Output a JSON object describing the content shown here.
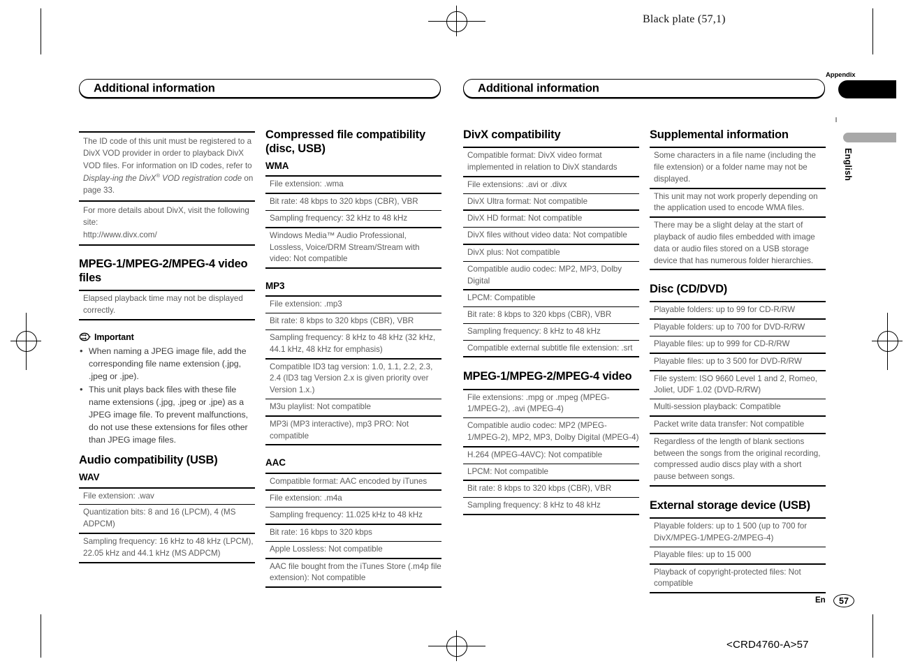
{
  "page": {
    "plate_label": "Black plate (57,1)",
    "footer_lang": "En",
    "footer_page_number": "57",
    "footer_code": "<CRD4760-A>57",
    "margin_tab_label": "Appendix",
    "margin_language": "English",
    "accent_color": "#000000",
    "tab_gray_color": "#a8a8a8",
    "body_text_color": "#5c5c5c"
  },
  "left_page": {
    "banner_title": "Additional information",
    "column1": {
      "notes": [
        {
          "id": "divx-vod-note",
          "segments": [
            {
              "text": "The ID code of this unit must be registered to a DivX VOD provider in order to playback DivX VOD files. For information on ID codes, refer to ",
              "style": "normal"
            },
            {
              "text": "Display-ing the DivX",
              "style": "italic"
            },
            {
              "text": "®",
              "style": "superscript-italic"
            },
            {
              "text": " VOD registration code",
              "style": "italic"
            },
            {
              "text": " on page 33.",
              "style": "normal"
            }
          ],
          "plain": "The ID code of this unit must be registered to a DivX VOD provider in order to playback DivX VOD files. For information on ID codes, refer to Displaying the DivX® VOD registration code on page 33."
        },
        {
          "id": "divx-site-note",
          "plain": "For more details about DivX, visit the following site:\nhttp://www.divx.com/"
        }
      ],
      "mpeg_video_files": {
        "heading": "MPEG-1/MPEG-2/MPEG-4 video files",
        "rows": [
          "Elapsed playback time may not be displayed correctly."
        ]
      },
      "important": {
        "icon": "important-icon",
        "label": "Important",
        "bullets": [
          "When naming a JPEG image file, add the corresponding file name extension (.jpg, .jpeg or .jpe).",
          "This unit plays back files with these file name extensions (.jpg, .jpeg or .jpe) as a JPEG image file. To prevent malfunctions, do not use these extensions for files other than JPEG image files."
        ]
      },
      "audio_compat_usb": {
        "heading": "Audio compatibility (USB)",
        "subheading": "WAV",
        "rows": [
          {
            "text": "File extension: .wav",
            "rule": "thin"
          },
          {
            "text": "Quantization bits: 8 and 16 (LPCM), 4 (MS ADPCM)",
            "rule": "thin"
          },
          {
            "text": "Sampling frequency: 16 kHz to 48 kHz (LPCM), 22.05 kHz and 44.1 kHz (MS ADPCM)",
            "rule": "none"
          }
        ]
      }
    },
    "column2": {
      "compressed_file": {
        "heading": "Compressed file compatibility (disc, USB)",
        "subheading": "WMA",
        "rows": [
          {
            "text": "File extension: .wma",
            "rule": "heavy"
          },
          {
            "text": "Bit rate: 48 kbps to 320 kbps (CBR), VBR",
            "rule": "thin"
          },
          {
            "text": "Sampling frequency: 32 kHz to 48 kHz",
            "rule": "heavy"
          },
          {
            "text": "Windows Media™ Audio Professional, Lossless, Voice/DRM Stream/Stream with video: Not compatible",
            "rule": "none"
          }
        ]
      },
      "mp3": {
        "subheading": "MP3",
        "rows": [
          {
            "text": "File extension: .mp3",
            "rule": "thin"
          },
          {
            "text": "Bit rate: 8 kbps to 320 kbps (CBR), VBR",
            "rule": "thin"
          },
          {
            "text": "Sampling frequency: 8 kHz to 48 kHz (32 kHz, 44.1 kHz, 48 kHz for emphasis)",
            "rule": "heavy"
          },
          {
            "text": "Compatible ID3 tag version: 1.0, 1.1, 2.2, 2.3, 2.4 (ID3 tag Version 2.x is given priority over Version 1.x.)",
            "rule": "thin"
          },
          {
            "text": "M3u playlist: Not compatible",
            "rule": "heavy"
          },
          {
            "text": "MP3i (MP3 interactive), mp3 PRO: Not compatible",
            "rule": "none"
          }
        ]
      },
      "aac": {
        "subheading": "AAC",
        "rows": [
          {
            "text": "Compatible format: AAC encoded by iTunes",
            "rule": "heavy"
          },
          {
            "text": "File extension: .m4a",
            "rule": "thin"
          },
          {
            "text": "Sampling frequency: 11.025 kHz to 48 kHz",
            "rule": "heavy"
          },
          {
            "text": "Bit rate: 16 kbps to 320 kbps",
            "rule": "thin"
          },
          {
            "text": "Apple Lossless: Not compatible",
            "rule": "heavy"
          },
          {
            "text": "AAC file bought from the iTunes Store (.m4p file extension): Not compatible",
            "rule": "none"
          }
        ]
      }
    }
  },
  "right_page": {
    "banner_title": "Additional information",
    "column3": {
      "divx": {
        "heading": "DivX compatibility",
        "rows": [
          {
            "text": "Compatible format: DivX video format implemented in relation to DivX standards",
            "rule": "heavy"
          },
          {
            "text": "File extensions: .avi or .divx",
            "rule": "thin"
          },
          {
            "text": "DivX Ultra format: Not compatible",
            "rule": "heavy"
          },
          {
            "text": "DivX HD format: Not compatible",
            "rule": "thin"
          },
          {
            "text": "DivX files without video data: Not compatible",
            "rule": "heavy"
          },
          {
            "text": "DivX plus: Not compatible",
            "rule": "thin"
          },
          {
            "text": "Compatible audio codec: MP2, MP3, Dolby Digital",
            "rule": "heavy"
          },
          {
            "text": "LPCM: Compatible",
            "rule": "thin"
          },
          {
            "text": "Bit rate: 8 kbps to 320 kbps (CBR), VBR",
            "rule": "thin"
          },
          {
            "text": "Sampling frequency: 8 kHz to 48 kHz",
            "rule": "thin"
          },
          {
            "text": "Compatible external subtitle file extension: .srt",
            "rule": "none"
          }
        ]
      },
      "mpeg_video": {
        "heading": "MPEG-1/MPEG-2/MPEG-4 video",
        "rows": [
          {
            "text": "File extensions: .mpg or .mpeg (MPEG-1/MPEG-2), .avi (MPEG-4)",
            "rule": "thin"
          },
          {
            "text": "Compatible audio codec: MP2 (MPEG-1/MPEG-2), MP2, MP3, Dolby Digital (MPEG-4)",
            "rule": "heavy"
          },
          {
            "text": "H.264 (MPEG-4AVC): Not compatible",
            "rule": "thin"
          },
          {
            "text": "LPCM: Not compatible",
            "rule": "heavy"
          },
          {
            "text": "Bit rate: 8 kbps to 320 kbps (CBR), VBR",
            "rule": "thin"
          },
          {
            "text": "Sampling frequency: 8 kHz to 48 kHz",
            "rule": "none"
          }
        ]
      }
    },
    "column4": {
      "supplemental": {
        "heading": "Supplemental information",
        "rows": [
          {
            "text": "Some characters in a file name (including the file extension) or a folder name may not be displayed.",
            "rule": "heavy"
          },
          {
            "text": "This unit may not work properly depending on the application used to encode WMA files.",
            "rule": "heavy"
          },
          {
            "text": "There may be a slight delay at the start of playback of audio files embedded with image data or audio files stored on a USB storage device that has numerous folder hierarchies.",
            "rule": "none"
          }
        ]
      },
      "disc": {
        "heading": "Disc (CD/DVD)",
        "rows": [
          {
            "text": "Playable folders: up to 99 for CD-R/RW",
            "rule": "heavy"
          },
          {
            "text": "Playable folders: up to 700 for DVD-R/RW",
            "rule": "thin"
          },
          {
            "text": "Playable files: up to 999 for CD-R/RW",
            "rule": "heavy"
          },
          {
            "text": "Playable files: up to 3 500 for DVD-R/RW",
            "rule": "heavy"
          },
          {
            "text": "File system: ISO 9660 Level 1 and 2, Romeo, Joliet, UDF 1.02 (DVD-R/RW)",
            "rule": "thin"
          },
          {
            "text": "Multi-session playback: Compatible",
            "rule": "heavy"
          },
          {
            "text": "Packet write data transfer: Not compatible",
            "rule": "heavy"
          },
          {
            "text": "Regardless of the length of blank sections between the songs from the original recording, compressed audio discs play with a short pause between songs.",
            "rule": "none"
          }
        ]
      },
      "external_storage": {
        "heading": "External storage device (USB)",
        "rows": [
          {
            "text": "Playable folders: up to 1 500 (up to 700 for DivX/MPEG-1/MPEG-2/MPEG-4)",
            "rule": "thin"
          },
          {
            "text": "Playable files: up to 15 000",
            "rule": "heavy"
          },
          {
            "text": "Playback of copyright-protected files: Not compatible",
            "rule": "none"
          }
        ]
      }
    }
  }
}
